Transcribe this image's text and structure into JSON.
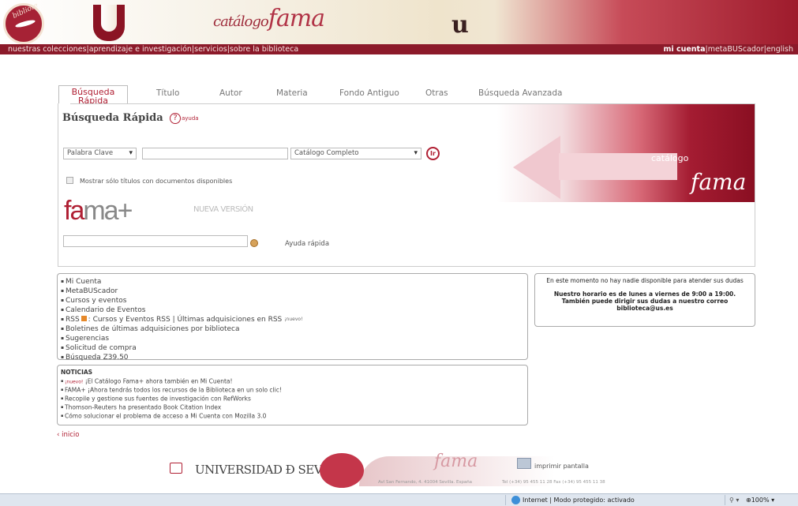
{
  "banner": {
    "seal_text": "bibliote",
    "catalog_small": "catálogo",
    "catalog_big": "fama",
    "u_letter": "u"
  },
  "nav": {
    "left": "nuestras colecciones|aprendizaje e investigación|servicios|sobre la biblioteca",
    "right_account": "mi cuenta",
    "right_rest": "|metaBUScador|english"
  },
  "tabs": {
    "active": "Búsqueda Rápida",
    "items": [
      "Título",
      "Autor",
      "Materia",
      "Fondo Antiguo",
      "Otras",
      "Búsqueda Avanzada"
    ]
  },
  "search": {
    "title": "Búsqueda Rápida",
    "help_glyph": "?",
    "help_label": "ayuda",
    "field_select": "Palabra Clave",
    "catalog_select": "Catálogo Completo",
    "go_label": "Ir",
    "available_label": "Mostrar sólo títulos con documentos disponibles",
    "fama_plus_f": "fa",
    "fama_plus_rest": "ma+",
    "new_version": "NUEVA VERSIÓN",
    "quick_help": "Ayuda rápida"
  },
  "promo": {
    "catalog": "catálogo",
    "fama": "fama"
  },
  "links": [
    "Mi Cuenta",
    "MetaBUScador",
    "Cursos y eventos",
    "Calendario de Eventos",
    "RSS",
    ": Cursos y Eventos RSS | Últimas adquisiciones en RSS",
    "¡nuevo!",
    "Boletines de últimas adquisiciones por biblioteca",
    "Sugerencias",
    "Solicitud de compra",
    "Búsqueda Z39.50"
  ],
  "status_box": {
    "line1": "En este momento no hay nadie disponible para atender sus dudas",
    "line2": "Nuestro horario es de lunes a viernes de 9:00 a 19:00.",
    "line3": "También puede dirigir sus dudas a nuestro correo",
    "email": "biblioteca@us.es"
  },
  "news": {
    "heading": "NOTICIAS",
    "new_tag": "¡nuevo!",
    "items": [
      "¡El Catálogo Fama+ ahora también en Mi Cuenta!",
      "FAMA+ ¡Ahora tendrás todos los recursos de la Biblioteca en un solo clic!",
      "Recopile y gestione sus fuentes de investigación con RefWorks",
      "Thomson-Reuters ha presentado Book Citation Index",
      "Cómo solucionar el problema de acceso a Mi Cuenta con Mozilla 3.0"
    ]
  },
  "back_link": "‹ inicio",
  "footer": {
    "university": "UNIVERSIDAD Ð SEVILLA",
    "fama": "fama",
    "address": "Avl San Fernando, 4. 41004 Sevilla. España",
    "print": "imprimir pantalla",
    "phone": "Tel (+34) 95 455 11 28 Fax (+34) 95 455 11 38"
  },
  "statusbar": {
    "zone": "Internet | Modo protegido: activado",
    "security": "⚲ ▾",
    "zoom": "⊕100%  ▾"
  }
}
